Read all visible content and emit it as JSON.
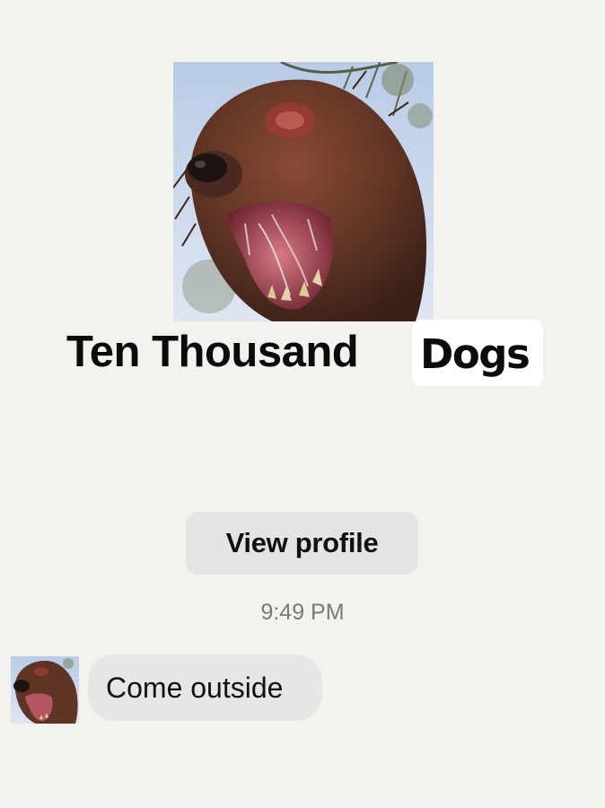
{
  "contact": {
    "name_part": "Ten Thousand",
    "name_highlight": "Dogs",
    "photo_icon": "dog-profile-photo"
  },
  "actions": {
    "view_profile_label": "View profile"
  },
  "conversation": {
    "timestamp": "9:49 PM",
    "messages": [
      {
        "sender_avatar": "dog-avatar-icon",
        "text": "Come outside"
      }
    ]
  },
  "colors": {
    "background": "#f3f2ee",
    "button_bg": "#e4e4e3",
    "bubble_bg": "#e6e6e5",
    "timestamp_text": "#7a7a78",
    "primary_text": "#111111"
  }
}
